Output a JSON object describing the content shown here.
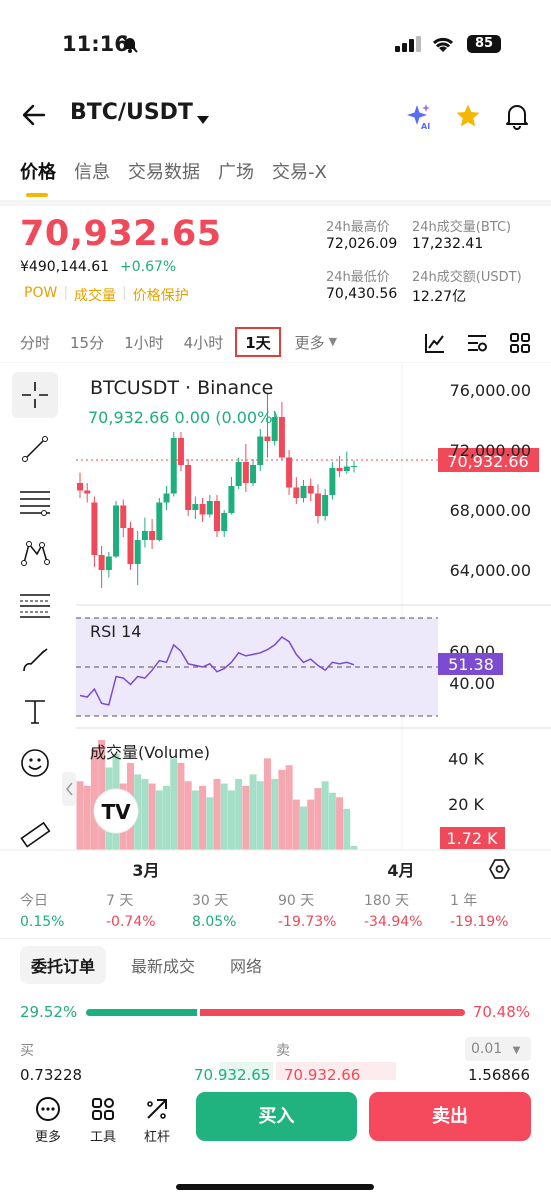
{
  "status_bar": {
    "time": "11:16",
    "battery": "85"
  },
  "header": {
    "title": "BTC/USDT",
    "icons": [
      "back-arrow-icon",
      "ai-sparkle-icon",
      "star-icon",
      "bell-icon"
    ]
  },
  "tabs": [
    "价格",
    "信息",
    "交易数据",
    "广场",
    "交易-X"
  ],
  "ticker": {
    "last_price": "70,932.65",
    "cny_price": "¥490,144.61",
    "change_pct": "+0.67%",
    "tags": [
      "POW",
      "成交量",
      "价格保护"
    ],
    "high_24h_label": "24h最高价",
    "high_24h": "72,026.09",
    "low_24h_label": "24h最低价",
    "low_24h": "70,430.56",
    "vol_btc_label": "24h成交量(BTC)",
    "vol_btc": "17,232.41",
    "vol_usdt_label": "24h成交额(USDT)",
    "vol_usdt": "12.27亿"
  },
  "timeframes": [
    "分时",
    "15分",
    "1小时",
    "4小时",
    "1天",
    "更多"
  ],
  "active_timeframe": "1天",
  "chart": {
    "symbol_label": "BTCUSDT · Binance",
    "ohlc_line": "70,932.66  0.00 (0.00%)",
    "current_price_tag": "70,932.66",
    "rsi_label": "RSI 14",
    "rsi_value": "51.38",
    "volume_label": "成交量(Volume)",
    "volume_value": "1.72 K",
    "x_labels": [
      "3月",
      "4月"
    ],
    "colors": {
      "up": "#1fae7d",
      "down": "#f04a5a",
      "rsi": "#7b4ccf",
      "rsi_band": "#eee8fb"
    }
  },
  "chart_data": [
    {
      "type": "candlestick",
      "title": "BTCUSDT · Binance",
      "y_ticks": [
        "76,000.00",
        "72,000.00",
        "68,000.00",
        "64,000.00"
      ],
      "ylim": [
        62000,
        77200
      ],
      "candles": [
        {
          "o": 69800,
          "h": 70500,
          "l": 68800,
          "c": 69300
        },
        {
          "o": 69300,
          "h": 69800,
          "l": 68500,
          "c": 69100
        },
        {
          "o": 68500,
          "h": 68900,
          "l": 64200,
          "c": 65000
        },
        {
          "o": 65000,
          "h": 65600,
          "l": 62800,
          "c": 64000
        },
        {
          "o": 64000,
          "h": 65200,
          "l": 63500,
          "c": 64900
        },
        {
          "o": 64900,
          "h": 68600,
          "l": 64800,
          "c": 68300
        },
        {
          "o": 68300,
          "h": 68700,
          "l": 66200,
          "c": 66800
        },
        {
          "o": 66800,
          "h": 67200,
          "l": 64000,
          "c": 64400
        },
        {
          "o": 64400,
          "h": 66600,
          "l": 63000,
          "c": 66000
        },
        {
          "o": 66000,
          "h": 67500,
          "l": 65500,
          "c": 66600
        },
        {
          "o": 66600,
          "h": 67400,
          "l": 65400,
          "c": 66000
        },
        {
          "o": 66000,
          "h": 68800,
          "l": 65900,
          "c": 68500
        },
        {
          "o": 68500,
          "h": 69600,
          "l": 68000,
          "c": 69100
        },
        {
          "o": 69100,
          "h": 73200,
          "l": 68900,
          "c": 72800
        },
        {
          "o": 72800,
          "h": 73200,
          "l": 70600,
          "c": 71000
        },
        {
          "o": 71000,
          "h": 71400,
          "l": 67600,
          "c": 68000
        },
        {
          "o": 68000,
          "h": 68900,
          "l": 67400,
          "c": 68400
        },
        {
          "o": 68400,
          "h": 68800,
          "l": 67200,
          "c": 67700
        },
        {
          "o": 67700,
          "h": 69000,
          "l": 67500,
          "c": 68600
        },
        {
          "o": 68600,
          "h": 69000,
          "l": 66200,
          "c": 66600
        },
        {
          "o": 66600,
          "h": 68000,
          "l": 66200,
          "c": 67800
        },
        {
          "o": 67800,
          "h": 70200,
          "l": 67700,
          "c": 69600
        },
        {
          "o": 69600,
          "h": 71500,
          "l": 69400,
          "c": 71200
        },
        {
          "o": 71200,
          "h": 72400,
          "l": 69200,
          "c": 69800
        },
        {
          "o": 69800,
          "h": 71400,
          "l": 69600,
          "c": 71000
        },
        {
          "o": 71000,
          "h": 73400,
          "l": 70600,
          "c": 72900
        },
        {
          "o": 72900,
          "h": 75800,
          "l": 71500,
          "c": 72600
        },
        {
          "o": 72600,
          "h": 74600,
          "l": 72300,
          "c": 74200
        },
        {
          "o": 74200,
          "h": 75200,
          "l": 71300,
          "c": 71500
        },
        {
          "o": 71500,
          "h": 72000,
          "l": 69000,
          "c": 69500
        },
        {
          "o": 69500,
          "h": 70200,
          "l": 68400,
          "c": 68800
        },
        {
          "o": 68800,
          "h": 70000,
          "l": 68500,
          "c": 69600
        },
        {
          "o": 69600,
          "h": 70100,
          "l": 68600,
          "c": 69100
        },
        {
          "o": 69100,
          "h": 69700,
          "l": 67100,
          "c": 67600
        },
        {
          "o": 67600,
          "h": 69400,
          "l": 67300,
          "c": 69000
        },
        {
          "o": 69000,
          "h": 71200,
          "l": 68700,
          "c": 70800
        },
        {
          "o": 70800,
          "h": 71600,
          "l": 70200,
          "c": 70600
        },
        {
          "o": 70600,
          "h": 71900,
          "l": 70400,
          "c": 70900
        },
        {
          "o": 70900,
          "h": 71300,
          "l": 70500,
          "c": 70933
        }
      ]
    },
    {
      "type": "line",
      "title": "RSI 14",
      "y_ticks": [
        "60.00",
        "40.00"
      ],
      "ylim": [
        19,
        81
      ],
      "values": [
        32,
        31,
        36,
        27,
        26,
        44,
        43,
        39,
        44,
        43,
        48,
        54,
        53,
        64,
        60,
        52,
        51,
        50,
        52,
        47,
        49,
        53,
        59,
        57,
        58,
        59,
        61,
        64,
        69,
        66,
        58,
        53,
        55,
        51,
        48,
        53,
        52,
        53,
        51.38
      ]
    },
    {
      "type": "bar",
      "title": "成交量(Volume)",
      "y_ticks": [
        "40 K",
        "20 K"
      ],
      "ylim": [
        0,
        48
      ],
      "values": [
        30,
        28,
        44,
        48,
        36,
        42,
        29,
        38,
        33,
        31,
        29,
        26,
        28,
        40,
        38,
        30,
        26,
        28,
        23,
        31,
        29,
        26,
        31,
        28,
        33,
        30,
        40,
        31,
        35,
        37,
        22,
        19,
        22,
        27,
        30,
        25,
        23,
        18,
        1.72
      ]
    }
  ],
  "performance": [
    {
      "label": "今日",
      "value": "0.15%"
    },
    {
      "label": "7 天",
      "value": "-0.74%"
    },
    {
      "label": "30 天",
      "value": "8.05%"
    },
    {
      "label": "90 天",
      "value": "-19.73%"
    },
    {
      "label": "180 天",
      "value": "-34.94%"
    },
    {
      "label": "1 年",
      "value": "-19.19%"
    }
  ],
  "orderbook": {
    "tabs": [
      "委托订单",
      "最新成交",
      "网络"
    ],
    "buy_pct": "29.52%",
    "sell_pct": "70.48%",
    "buy_ratio": 0.2952,
    "buy_label": "买",
    "sell_label": "卖",
    "precision": "0.01",
    "row": {
      "bid_qty": "0.73228",
      "bid_price": "70,932.65",
      "ask_price": "70,932.66",
      "ask_qty": "1.56866"
    }
  },
  "bottom_bar": {
    "more": "更多",
    "tools": "工具",
    "leverage": "杠杆",
    "buy": "买入",
    "sell": "卖出"
  }
}
